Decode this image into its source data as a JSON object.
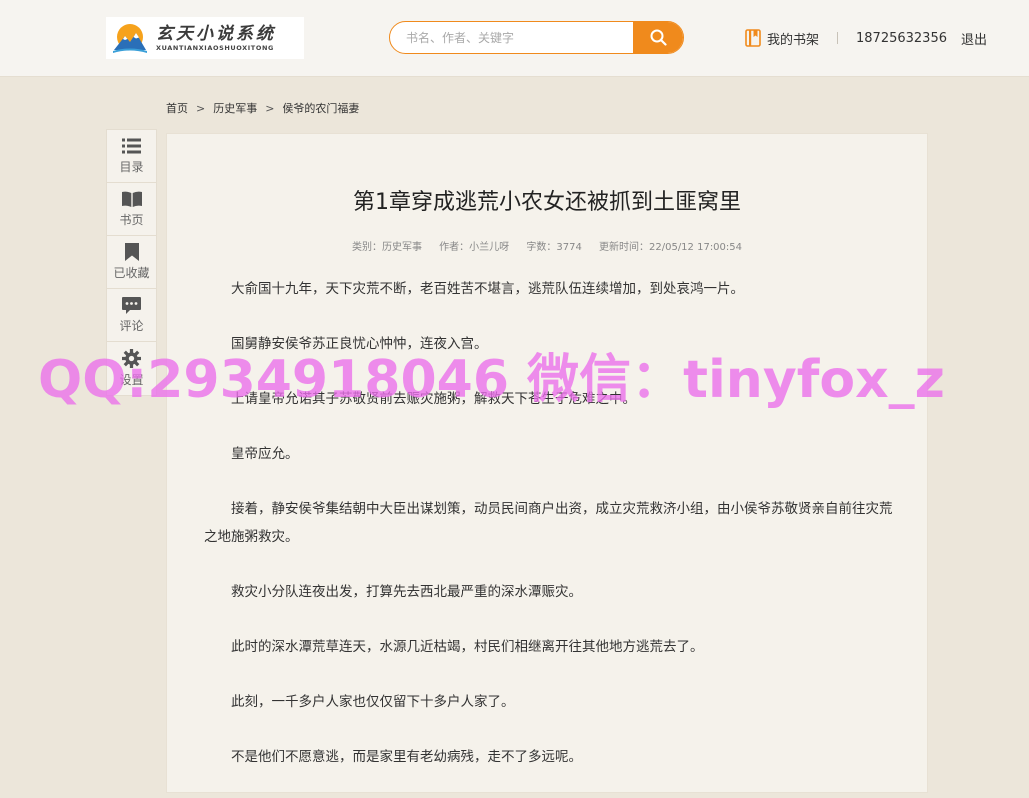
{
  "header": {
    "logo_title": "玄天小说系统",
    "logo_sub": "XUANTIANXIAOSHUOXITONG",
    "search_placeholder": "书名、作者、关键字",
    "bookshelf_label": "我的书架",
    "phone": "18725632356",
    "logout_label": "退出",
    "accent_color": "#f08a1c"
  },
  "breadcrumb": {
    "home": "首页",
    "category": "历史军事",
    "book": "侯爷的农门福妻",
    "separator": ">"
  },
  "sidebar": {
    "items": [
      {
        "label": "目录",
        "icon": "list-icon"
      },
      {
        "label": "书页",
        "icon": "book-icon"
      },
      {
        "label": "已收藏",
        "icon": "bookmark-icon"
      },
      {
        "label": "评论",
        "icon": "comment-icon"
      },
      {
        "label": "设置",
        "icon": "gear-icon"
      }
    ]
  },
  "chapter": {
    "title": "第1章穿成逃荒小农女还被抓到土匪窝里",
    "category": "类别：历史军事",
    "author": "作者：小兰儿呀",
    "word_count": "字数：3774",
    "updated": "更新时间：22/05/12 17:00:54",
    "paragraphs": [
      "大俞国十九年，天下灾荒不断，老百姓苦不堪言，逃荒队伍连续增加，到处哀鸿一片。",
      "国舅静安侯爷苏正良忧心忡忡，连夜入宫。",
      "上请皇帝允诺其子苏敬贤前去赈灾施粥，解救天下苍生于危难之中。",
      "皇帝应允。",
      "接着，静安侯爷集结朝中大臣出谋划策，动员民间商户出资，成立灾荒救济小组，由小侯爷苏敬贤亲自前往灾荒之地施粥救灾。",
      "救灾小分队连夜出发，打算先去西北最严重的深水潭赈灾。",
      "此时的深水潭荒草连天，水源几近枯竭，村民们相继离开往其他地方逃荒去了。",
      "此刻，一千多户人家也仅仅留下十多户人家了。",
      "不是他们不愿意逃，而是家里有老幼病残，走不了多远呢。"
    ]
  },
  "watermark": "QQ:2934918046 微信：tinyfox_z"
}
